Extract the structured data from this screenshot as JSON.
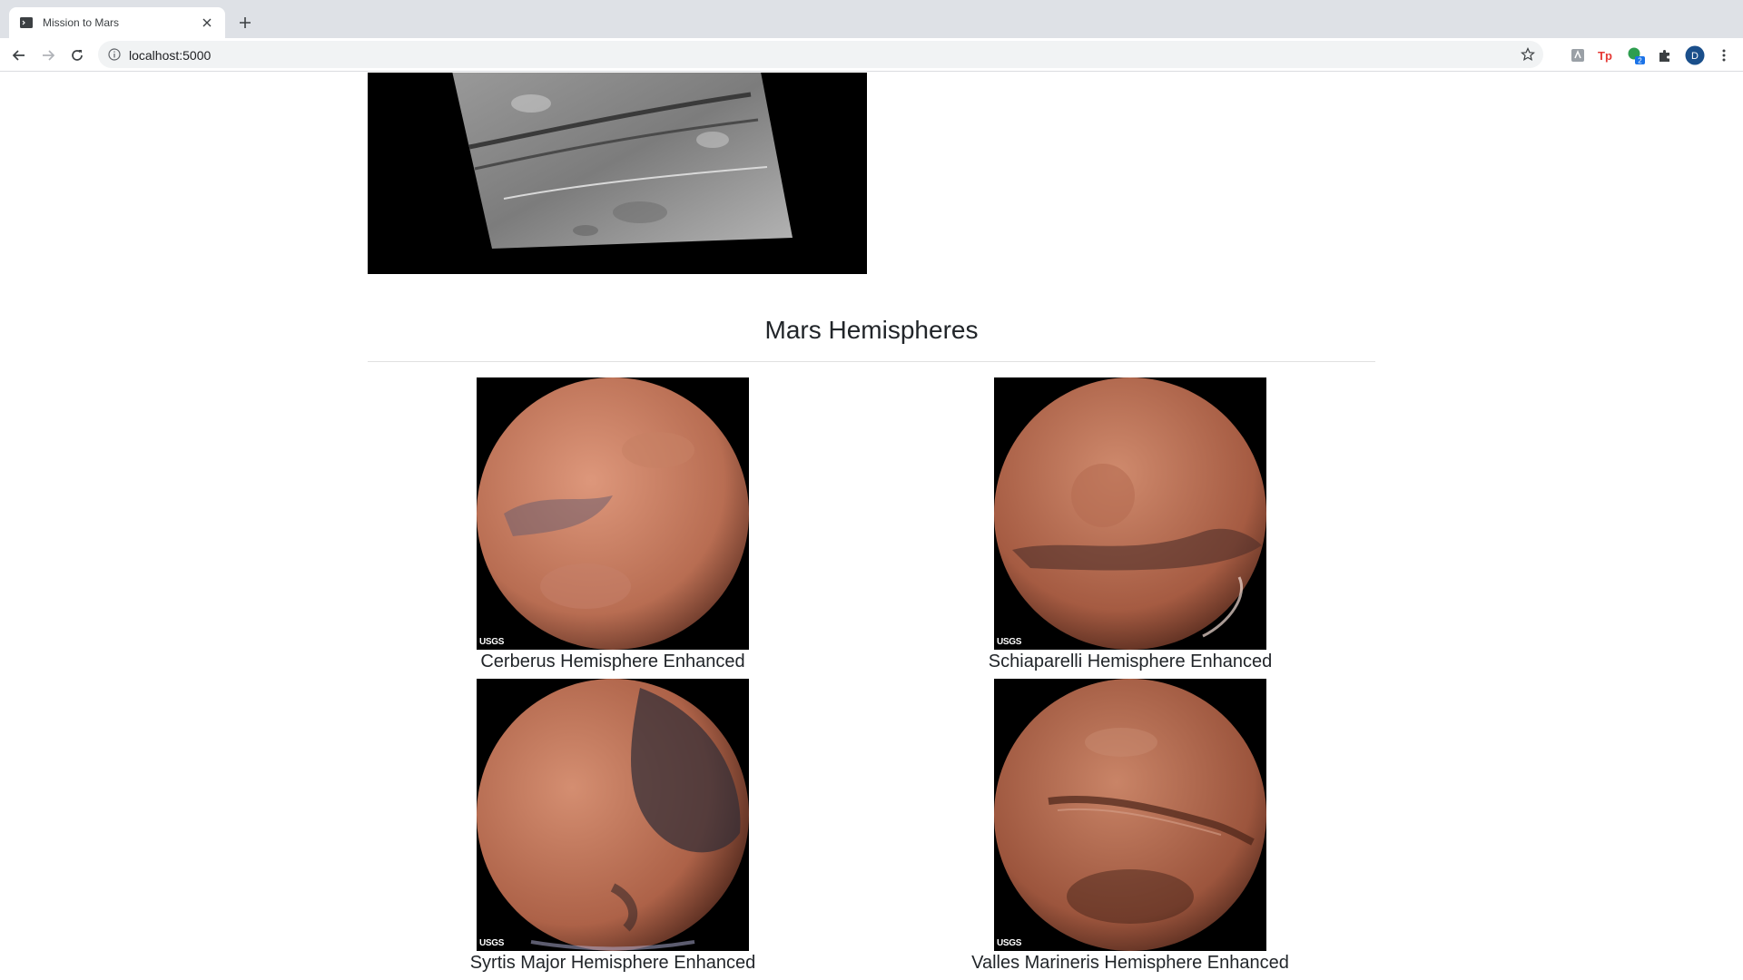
{
  "browser": {
    "tab_title": "Mission to Mars",
    "url": "localhost:5000",
    "extension_badge": "2",
    "profile_initial": "D"
  },
  "page": {
    "hemispheres_title": "Mars Hemispheres",
    "hemispheres": [
      {
        "title": "Cerberus Hemisphere Enhanced"
      },
      {
        "title": "Schiaparelli Hemisphere Enhanced"
      },
      {
        "title": "Syrtis Major Hemisphere Enhanced"
      },
      {
        "title": "Valles Marineris Hemisphere Enhanced"
      }
    ],
    "image_watermark": "USGS"
  },
  "colors": {
    "tabstrip": "#dee1e6",
    "mars_light": "#d0866a",
    "mars_dark": "#8a4a38",
    "profile_avatar": "#1a4f8b"
  }
}
